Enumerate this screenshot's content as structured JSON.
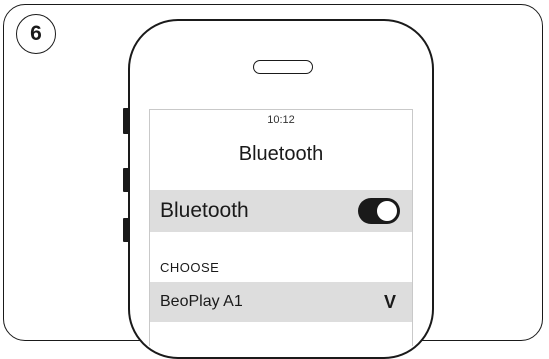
{
  "step": {
    "number": "6"
  },
  "screen": {
    "status_time": "10:12",
    "title": "Bluetooth",
    "bluetooth_row": {
      "label": "Bluetooth",
      "toggle_on": true
    },
    "section_header": "CHOOSE",
    "devices": [
      {
        "name": "BeoPlay A1",
        "selected": true,
        "check_glyph": "V"
      }
    ]
  },
  "colors": {
    "ink": "#1a1a1a",
    "row_highlight": "#dddddd",
    "screen_border": "#c9c9c9"
  },
  "icons": [
    "toggle-switch-icon",
    "checkmark-icon",
    "earpiece-icon"
  ]
}
